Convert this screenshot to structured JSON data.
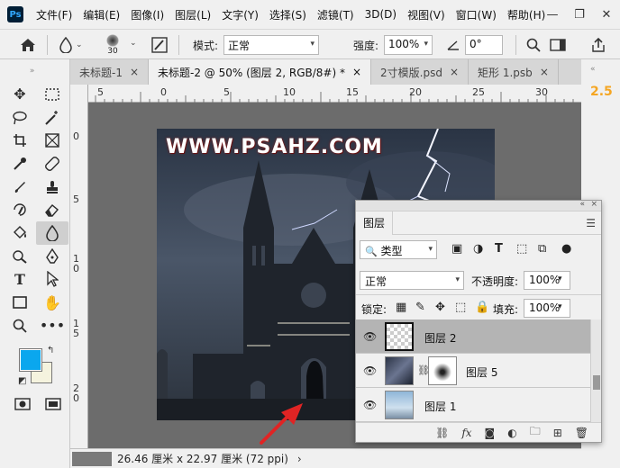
{
  "menubar": {
    "app_icon": "Ps",
    "items": [
      "文件(F)",
      "编辑(E)",
      "图像(I)",
      "图层(L)",
      "文字(Y)",
      "选择(S)",
      "滤镜(T)",
      "3D(D)",
      "视图(V)",
      "窗口(W)",
      "帮助(H)"
    ],
    "window_controls": [
      "—",
      "❐",
      "✕"
    ]
  },
  "options": {
    "brush_size": "30",
    "mode_label": "模式:",
    "mode_value": "正常",
    "strength_label": "强度:",
    "strength_value": "100%",
    "angle_value": "0°"
  },
  "tabs": [
    {
      "label": "未标题-1",
      "close": "×",
      "active": false
    },
    {
      "label": "未标题-2 @ 50% (图层 2, RGB/8#) *",
      "close": "×",
      "active": true
    },
    {
      "label": "2寸模版.psd",
      "close": "×",
      "active": false
    },
    {
      "label": "矩形 1.psb",
      "close": "×",
      "active": false
    }
  ],
  "rulers": {
    "horizontal": [
      "5",
      "0",
      "5",
      "10",
      "15",
      "20",
      "25",
      "30"
    ],
    "vertical": [
      "0",
      "5",
      "1\n0",
      "1\n5",
      "2\n0"
    ]
  },
  "canvas": {
    "watermark": "WWW.PSAHZ.COM"
  },
  "right_panel": {
    "value": "2.5"
  },
  "status": {
    "dimensions": "26.46 厘米 x 22.97 厘米 (72 ppi)",
    "chevron": "›"
  },
  "layers_panel": {
    "tab": "图层",
    "filter_value": "类型",
    "blend_mode": "正常",
    "opacity_label": "不透明度:",
    "opacity_value": "100%",
    "lock_label": "锁定:",
    "fill_label": "填充:",
    "fill_value": "100%",
    "layers": [
      {
        "name": "图层 2",
        "selected": true
      },
      {
        "name": "图层 5",
        "selected": false
      },
      {
        "name": "图层 1",
        "selected": false
      }
    ]
  },
  "colors": {
    "foreground": "#0aa7ee",
    "background": "#f5f3de",
    "arrow": "#e02424"
  }
}
